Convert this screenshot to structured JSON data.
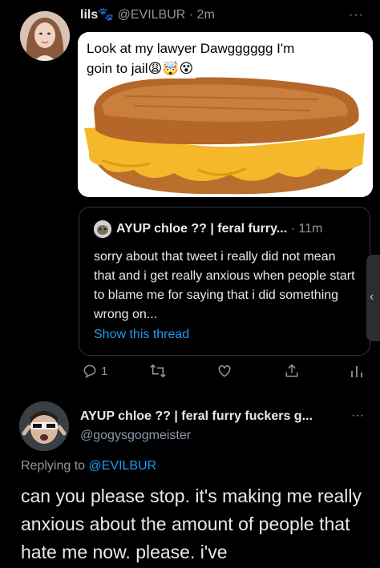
{
  "tweet": {
    "author_name": "lils",
    "author_emoji": "🐾",
    "handle_time": "@EVILBUR · 2m",
    "more_icon": "more-dots-icon",
    "meme": {
      "caption_line1": "Look at my lawyer Dawgggggg I'm",
      "caption_line2": "goin to jail",
      "caption_emojis": "😩🤯😵"
    }
  },
  "quote": {
    "name": "AYUP chloe ?? | feral furry...",
    "time": "· 11m",
    "text": "sorry about that tweet i really did not mean that and i get really anxious when people start to blame me for saying that i did something wrong on...",
    "show_thread": "Show this thread"
  },
  "actions": {
    "reply_count": "1",
    "retweet_count": "",
    "like_count": "",
    "share": "",
    "analytics": ""
  },
  "reply": {
    "name": "AYUP chloe ?? | feral furry fuckers g...",
    "more": "···",
    "handle": "@gogysgogmeister",
    "replying_to_prefix": "Replying to",
    "replying_to_handle": "@EVILBUR",
    "text": "can you please stop. it's making me really anxious about the amount of people that hate me now. please. i've"
  },
  "colors": {
    "background": "#000000",
    "text": "#e7e9ea",
    "muted": "#8b98a5",
    "accent": "#1d9bf0",
    "border": "#333333"
  }
}
